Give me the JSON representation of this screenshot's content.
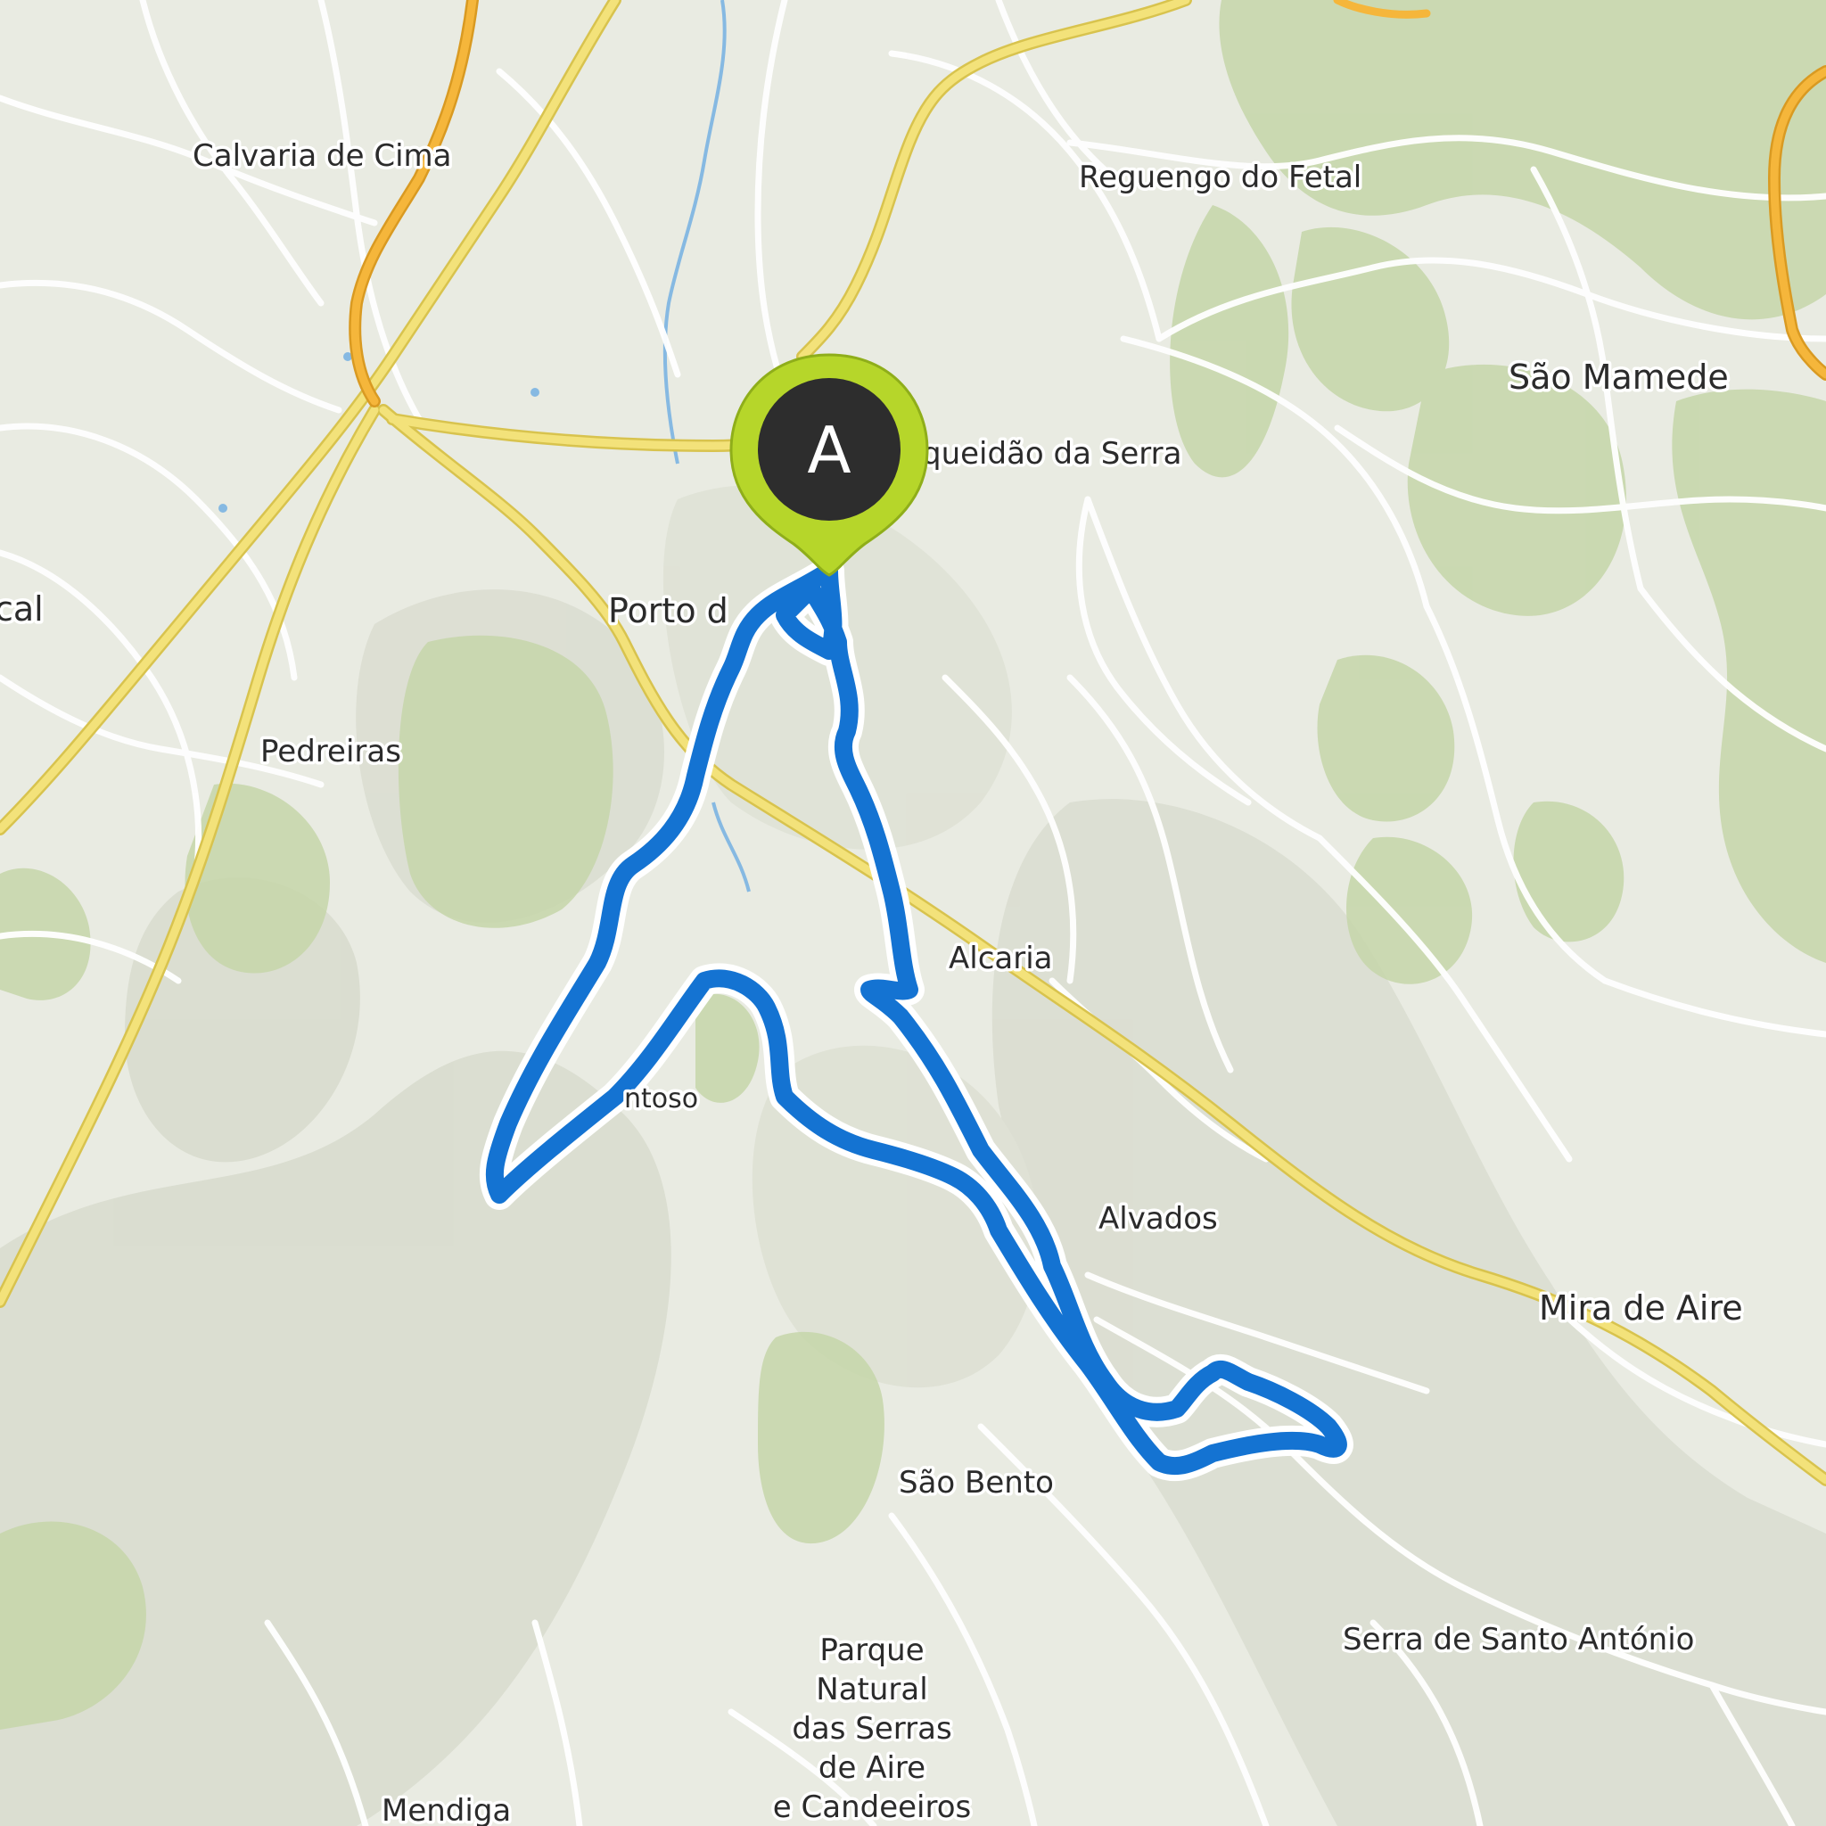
{
  "map": {
    "kind": "topographic trail map",
    "colors": {
      "land": "#e9ebe2",
      "hills": "#d6d9cb",
      "forest": "#c3d4a6",
      "road_minor": "#ffffff",
      "road_major": "#f3e27a",
      "road_major_edge": "#d8c34e",
      "motorway": "#f5b63b",
      "water": "#7fb6e3",
      "route": "#1473d2",
      "route_outline": "#ffffff",
      "marker_fill": "#2d2d2d",
      "marker_ring": "#b6d62a",
      "marker_letter": "#ffffff"
    }
  },
  "places": [
    {
      "id": "calvaria-de-cima",
      "name": "Calvaria de Cima"
    },
    {
      "id": "reguengo-do-fetal",
      "name": "Reguengo do Fetal"
    },
    {
      "id": "sao-mamede",
      "name": "São Mamede"
    },
    {
      "id": "arqueidao-da-serra",
      "name": "queidão da Serra"
    },
    {
      "id": "porto",
      "name": "Porto d"
    },
    {
      "id": "west-edge",
      "name": "cal"
    },
    {
      "id": "pedreiras",
      "name": "Pedreiras"
    },
    {
      "id": "alcaria",
      "name": "Alcaria"
    },
    {
      "id": "santoso",
      "name": "ntoso"
    },
    {
      "id": "alvados",
      "name": "Alvados"
    },
    {
      "id": "mira-de-aire",
      "name": "Mira de Aire"
    },
    {
      "id": "sao-bento",
      "name": "São Bento"
    },
    {
      "id": "serra-santo-antonio",
      "name": "Serra de Santo António"
    },
    {
      "id": "park-line-1",
      "name": "Parque"
    },
    {
      "id": "park-line-2",
      "name": "Natural"
    },
    {
      "id": "park-line-3",
      "name": "das Serras"
    },
    {
      "id": "park-line-4",
      "name": "de Aire"
    },
    {
      "id": "park-line-5",
      "name": "e Candeeiros"
    },
    {
      "id": "mendiga",
      "name": "Mendiga"
    }
  ],
  "start_marker": {
    "letter": "A",
    "icon": "map-pin-icon"
  }
}
